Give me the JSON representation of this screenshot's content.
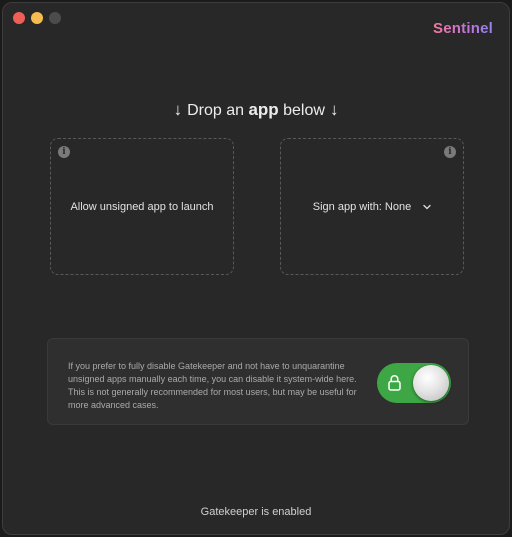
{
  "app": {
    "brand": "Sentinel"
  },
  "drop": {
    "prefix": "Drop an",
    "emphasis": "app",
    "suffix": "below"
  },
  "dropzones": {
    "left": {
      "label": "Allow unsigned app to launch",
      "info_icon": "i"
    },
    "right": {
      "label": "Sign app with: None",
      "info_icon": "i"
    }
  },
  "gatekeeper_panel": {
    "description": "If you prefer to fully disable Gatekeeper and not have to unquarantine unsigned apps manually each time, you can disable it system-wide here. This is not generally recommended for most users, but may be useful for more advanced cases.",
    "toggle_on": true
  },
  "status": {
    "text": "Gatekeeper is enabled"
  },
  "colors": {
    "toggle_on": "#3ea745",
    "window_bg": "#282828",
    "brand_gradient": [
      "#f37b9c",
      "#c572d8",
      "#8f83ef"
    ]
  },
  "icons": [
    "arrow-down-icon",
    "info-icon",
    "chevron-down-icon",
    "lock-icon"
  ]
}
